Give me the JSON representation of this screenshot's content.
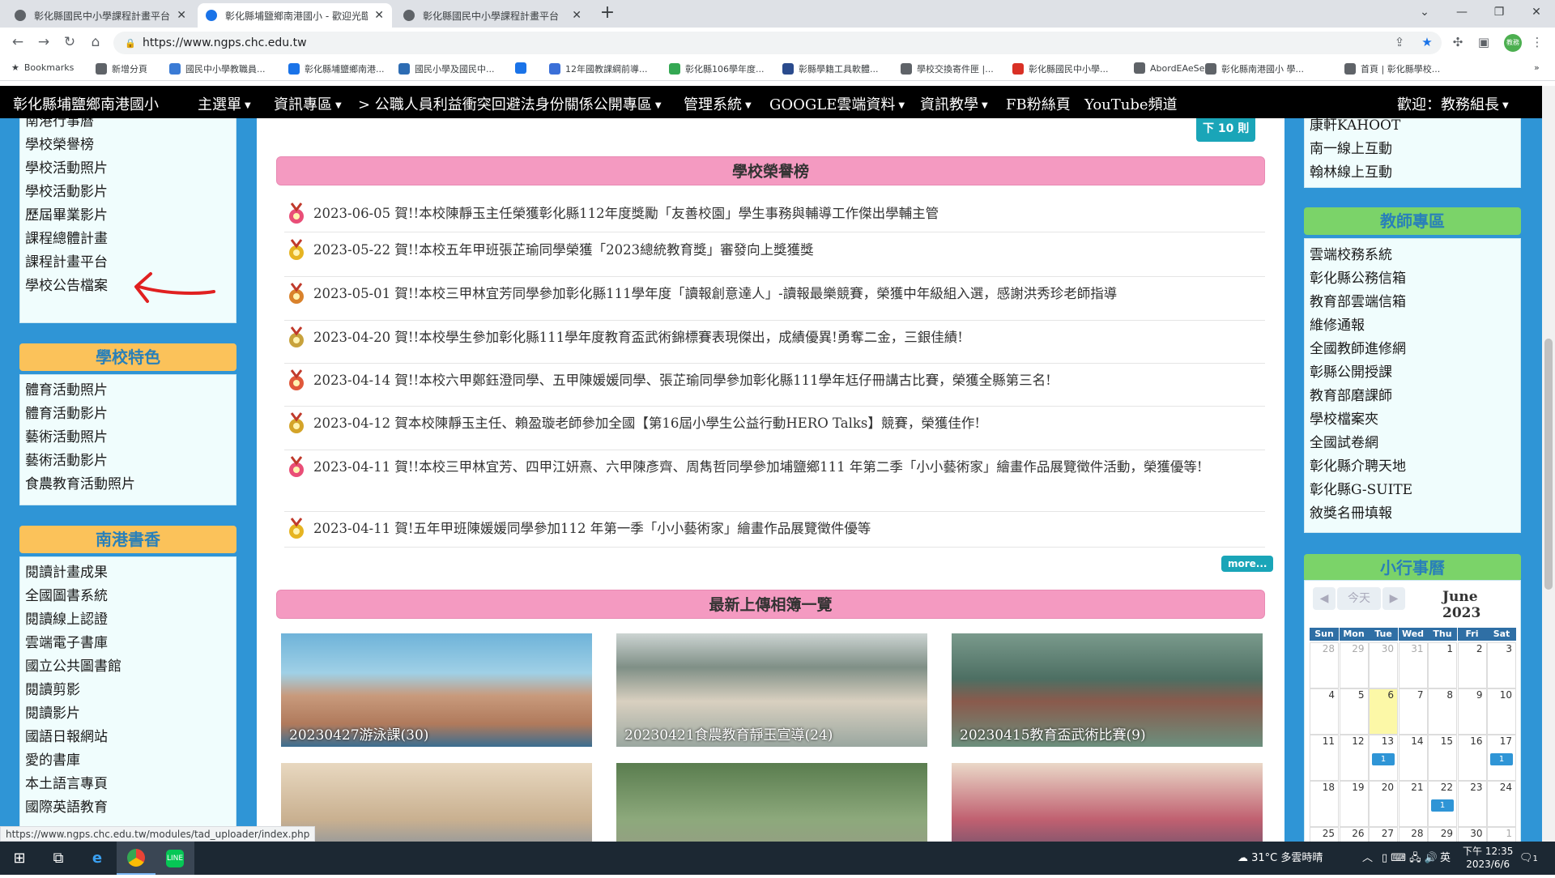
{
  "browser": {
    "tabs": [
      {
        "title": "彰化縣國民中小學課程計畫平台",
        "active": false
      },
      {
        "title": "彰化縣埔鹽鄉南港國小 - 歡迎光臨",
        "active": true
      },
      {
        "title": "彰化縣國民中小學課程計畫平台",
        "active": false
      }
    ],
    "new_tab": "+",
    "url": "https://www.ngps.chc.edu.tw",
    "bookmarks_label": "Bookmarks",
    "bookmarks": [
      "新增分頁",
      "國民中小學教職員...",
      "彰化縣埔鹽鄉南港...",
      "國民小學及國民中...",
      "",
      "12年國教課綱前導...",
      "彰化縣106學年度...",
      "彰縣學籍工具軟體...",
      "學校交換寄件匣 |...",
      "彰化縣國民中小學...",
      "AbordEAeSe",
      "彰化縣南港國小 學...",
      "首頁 | 彰化縣學校..."
    ],
    "profile_label": "教務",
    "status_url": "https://www.ngps.chc.edu.tw/modules/tad_uploader/index.php"
  },
  "sitenav": {
    "brand": "彰化縣埔鹽鄉南港國小",
    "items": [
      "主選單",
      "資訊專區",
      "> 公職人員利益衝突回避法身份關係公開專區",
      "管理系統",
      "GOOGLE雲端資料",
      "資訊教學",
      "FB粉絲頁",
      "YouTube頻道"
    ],
    "welcome": "歡迎：教務組長"
  },
  "left": {
    "top_links": [
      "南港行事曆",
      "學校榮譽榜",
      "學校活動照片",
      "學校活動影片",
      "歷屆畢業影片",
      "課程總體計畫",
      "課程計畫平台",
      "學校公告檔案"
    ],
    "features_title": "學校特色",
    "features": [
      "體育活動照片",
      "體育活動影片",
      "藝術活動照片",
      "藝術活動影片",
      "食農教育活動照片"
    ],
    "books_title": "南港書香",
    "books": [
      "閱讀計畫成果",
      "全國圖書系統",
      "閱讀線上認證",
      "雲端電子書庫",
      "國立公共圖書館",
      "閱讀剪影",
      "閱讀影片",
      "國語日報網站",
      "愛的書庫",
      "本土語言專頁",
      "國際英語教育"
    ]
  },
  "main": {
    "prev_button": "下 10 則",
    "honor_title": "學校榮譽榜",
    "honors": [
      {
        "date": "2023-06-05",
        "text": "賀!!本校陳靜玉主任榮獲彰化縣112年度獎勵「友善校園」學生事務與輔導工作傑出學輔主管"
      },
      {
        "date": "2023-05-22",
        "text": "賀!!本校五年甲班張芷瑜同學榮獲「2023總統教育獎」審發向上獎獲獎"
      },
      {
        "date": "2023-05-01",
        "text": "賀!!本校三甲林宜芳同學參加彰化縣111學年度「讀報創意達人」-讀報最樂競賽，榮獲中年級組入選，感謝洪秀珍老師指導"
      },
      {
        "date": "2023-04-20",
        "text": "賀!!本校學生參加彰化縣111學年度教育盃武術錦標賽表現傑出，成績優異!勇奪二金，三銀佳績!"
      },
      {
        "date": "2023-04-14",
        "text": "賀!!本校六甲鄭鈺澄同學、五甲陳媛媛同學、張芷瑜同學參加彰化縣111學年尪仔冊講古比賽，榮獲全縣第三名!"
      },
      {
        "date": "2023-04-12",
        "text": "賀本校陳靜玉主任、賴盈璇老師參加全國【第16屆小學生公益行動HERO Talks】競賽，榮獲佳作!"
      },
      {
        "date": "2023-04-11",
        "text": "賀!!本校三甲林宜芳、四甲江妍熹、六甲陳彥齊、周雋哲同學參加埔鹽鄉111 年第二季「小小藝術家」繪畫作品展覽徵件活動，榮獲優等!"
      },
      {
        "date": "2023-04-11",
        "text": "賀!五年甲班陳媛媛同學參加112 年第一季「小小藝術家」繪畫作品展覽徵件優等"
      }
    ],
    "more_label": "more...",
    "album_title": "最新上傳相簿一覽",
    "albums": [
      "20230427游泳課(30)",
      "20230421食農教育靜玉宣導(24)",
      "20230415教育盃武術比賽(9)",
      "",
      "",
      ""
    ]
  },
  "right": {
    "top_links": [
      "康軒KAHOOT",
      "南一線上互動",
      "翰林線上互動"
    ],
    "teacher_title": "教師專區",
    "teacher_links": [
      "雲端校務系統",
      "彰化縣公務信箱",
      "教育部雲端信箱",
      "維修通報",
      "全國教師進修網",
      "彰縣公開授課",
      "教育部磨課師",
      "學校檔案夾",
      "全國試卷網",
      "彰化縣介聘天地",
      "彰化縣G-SUITE",
      "敘獎名冊填報"
    ],
    "calendar_title": "小行事曆",
    "calendar": {
      "today_label": "今天",
      "month": "June 2023",
      "weekdays": [
        "Sun",
        "Mon",
        "Tue",
        "Wed",
        "Thu",
        "Fri",
        "Sat"
      ],
      "weeks": [
        [
          "28",
          "29",
          "30",
          "31",
          "1",
          "2",
          "3"
        ],
        [
          "4",
          "5",
          "6",
          "7",
          "8",
          "9",
          "10"
        ],
        [
          "11",
          "12",
          "13",
          "14",
          "15",
          "16",
          "17"
        ],
        [
          "18",
          "19",
          "20",
          "21",
          "22",
          "23",
          "24"
        ],
        [
          "25",
          "26",
          "27",
          "28",
          "29",
          "30",
          "1"
        ]
      ],
      "event_label": "1"
    }
  },
  "taskbar": {
    "weather": "31°C 多雲時晴",
    "ime": "英",
    "time": "下午 12:35",
    "date": "2023/6/6",
    "notifications": "1"
  },
  "colors": {
    "nav_bg": "#000000",
    "page_bg": "#2f95d6",
    "honor_head": "#f49ac1",
    "left_head": "#fbc25a",
    "right_head": "#7bd369",
    "arrow": "#e02020"
  }
}
